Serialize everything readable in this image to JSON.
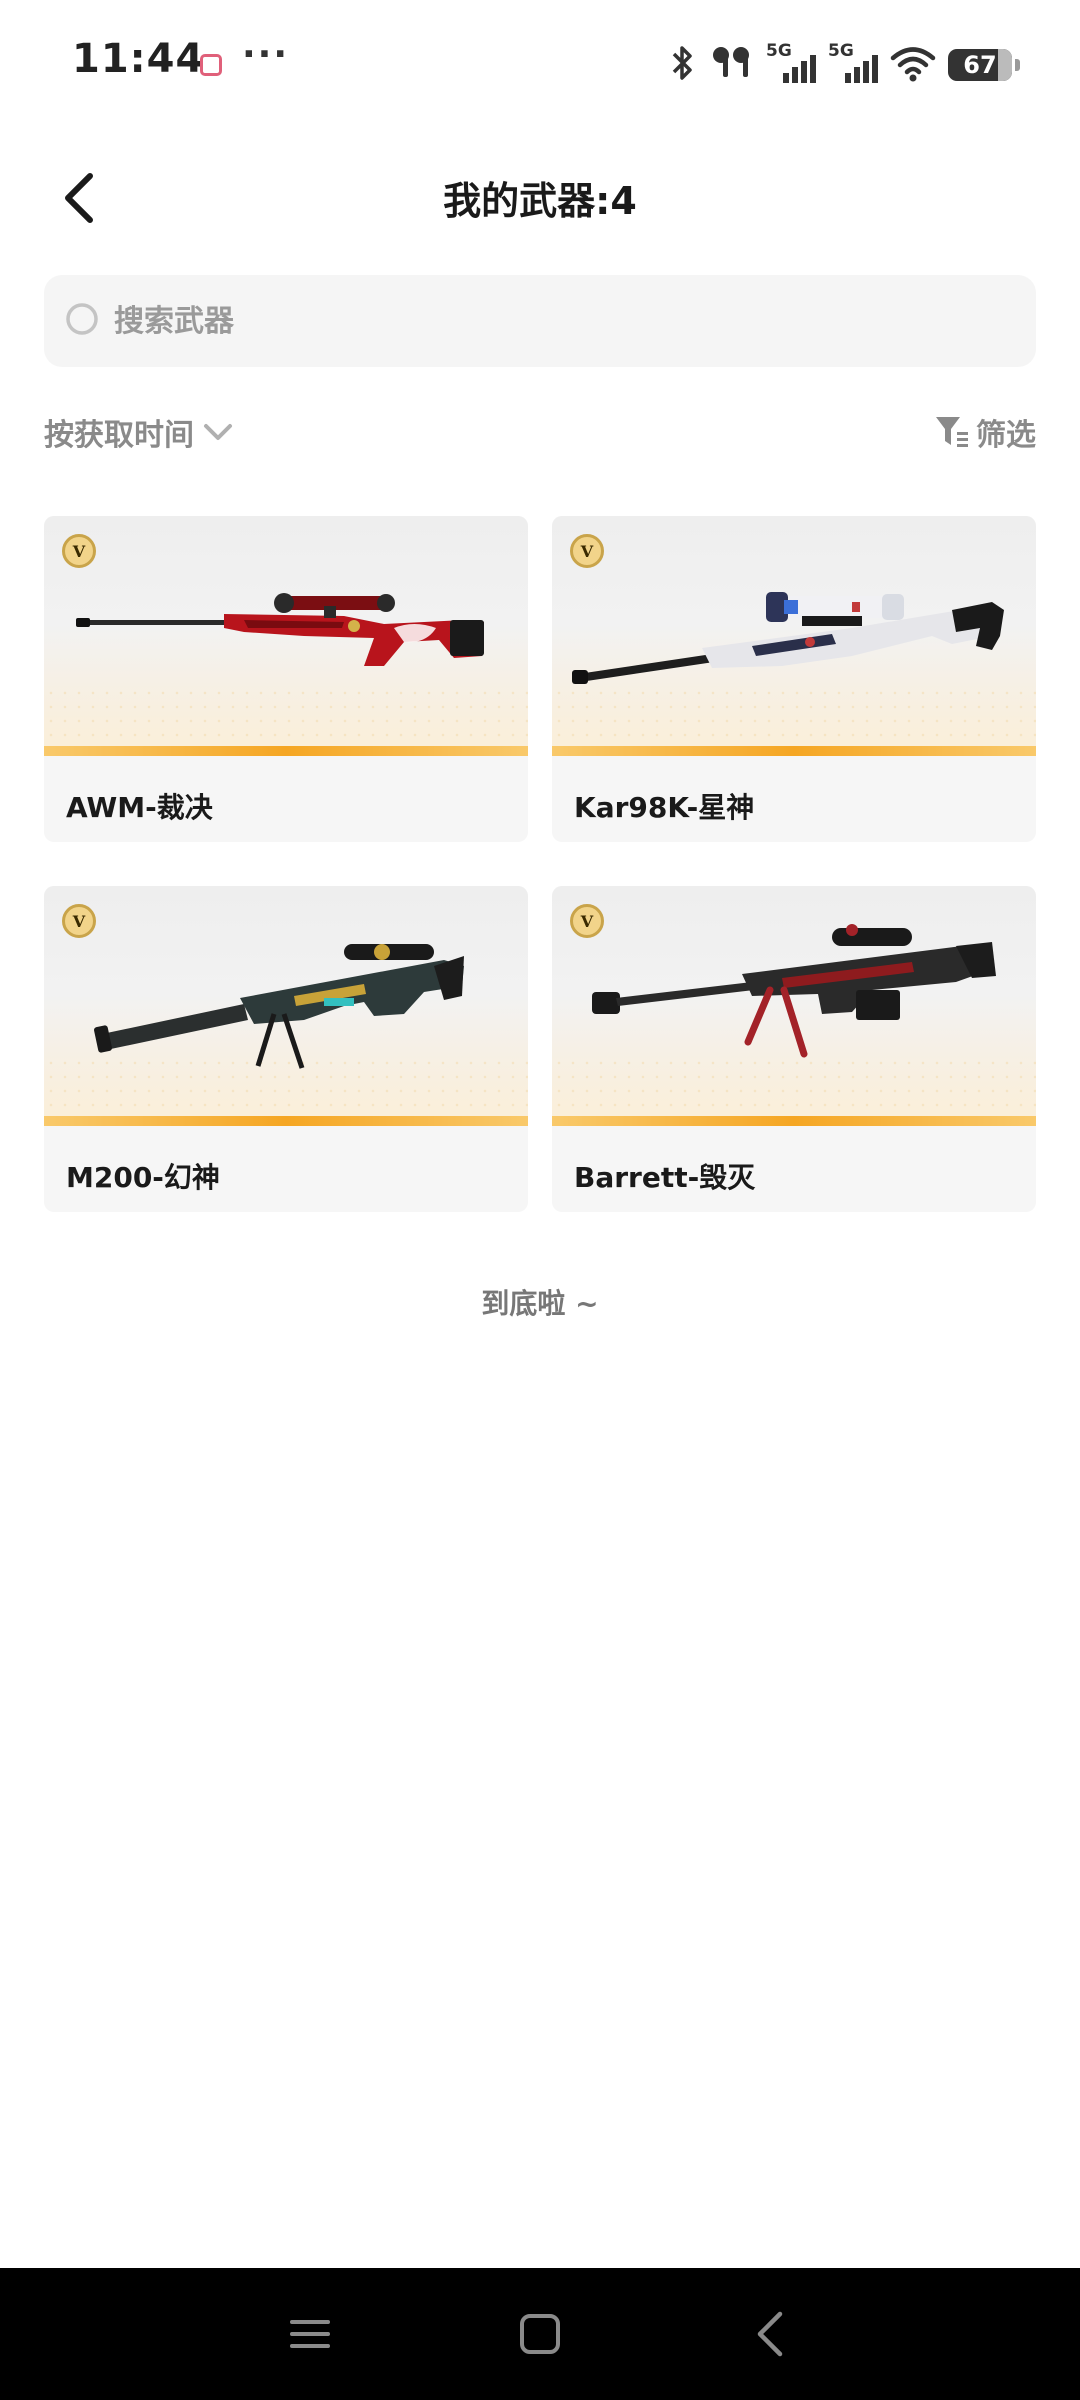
{
  "status_bar": {
    "time": "11:44",
    "dots": "···",
    "network_1": "5G",
    "network_2": "5G",
    "battery": "67"
  },
  "header": {
    "back_icon": "chevron-left-icon",
    "title": "我的武器:4"
  },
  "search": {
    "placeholder": "搜索武器",
    "value": ""
  },
  "sort": {
    "label": "按获取时间",
    "icon": "chevron-down-icon"
  },
  "filter": {
    "label": "筛选",
    "icon": "filter-icon"
  },
  "weapons": [
    {
      "name": "AWM-裁决",
      "badge": "V",
      "skin_color": "#b8141c"
    },
    {
      "name": "Kar98K-星神",
      "badge": "V",
      "skin_color": "#e6e6ea"
    },
    {
      "name": "M200-幻神",
      "badge": "V",
      "skin_color": "#2d3a3a"
    },
    {
      "name": "Barrett-毁灭",
      "badge": "V",
      "skin_color": "#2a2a2a"
    }
  ],
  "end_hint": "到底啦 ~",
  "nav": {
    "menu_icon": "menu-icon",
    "home_icon": "home-square-icon",
    "back_icon": "back-triangle-icon"
  },
  "colors": {
    "accent_orange": "#f5a623",
    "badge_gold": "#f2d48a",
    "muted_text": "#8a8a8a"
  }
}
